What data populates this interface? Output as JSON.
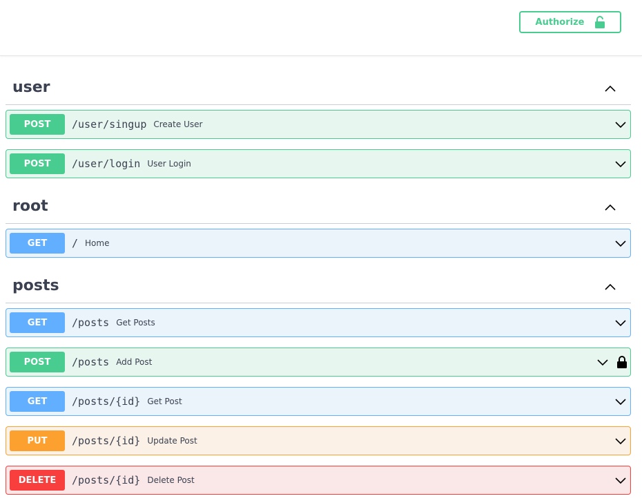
{
  "header": {
    "authorize_label": "Authorize",
    "authorize_icon": "lock-open-icon",
    "accent_color": "#49cc90"
  },
  "sections": [
    {
      "title": "user",
      "toggle_icon": "chevron-up-icon",
      "operations": [
        {
          "method": "POST",
          "path": "/user/singup",
          "summary": "Create User",
          "locked": false
        },
        {
          "method": "POST",
          "path": "/user/login",
          "summary": "User Login",
          "locked": false
        }
      ]
    },
    {
      "title": "root",
      "toggle_icon": "chevron-up-icon",
      "operations": [
        {
          "method": "GET",
          "path": "/",
          "summary": "Home",
          "locked": false
        }
      ]
    },
    {
      "title": "posts",
      "toggle_icon": "chevron-up-icon",
      "operations": [
        {
          "method": "GET",
          "path": "/posts",
          "summary": "Get Posts",
          "locked": false
        },
        {
          "method": "POST",
          "path": "/posts",
          "summary": "Add Post",
          "locked": true
        },
        {
          "method": "GET",
          "path": "/posts/{id}",
          "summary": "Get Post",
          "locked": false
        },
        {
          "method": "PUT",
          "path": "/posts/{id}",
          "summary": "Update Post",
          "locked": false
        },
        {
          "method": "DELETE",
          "path": "/posts/{id}",
          "summary": "Delete Post",
          "locked": false
        }
      ]
    }
  ],
  "colors": {
    "post": "#49cc90",
    "get": "#61affe",
    "put": "#fca130",
    "delete": "#f93e3e"
  }
}
